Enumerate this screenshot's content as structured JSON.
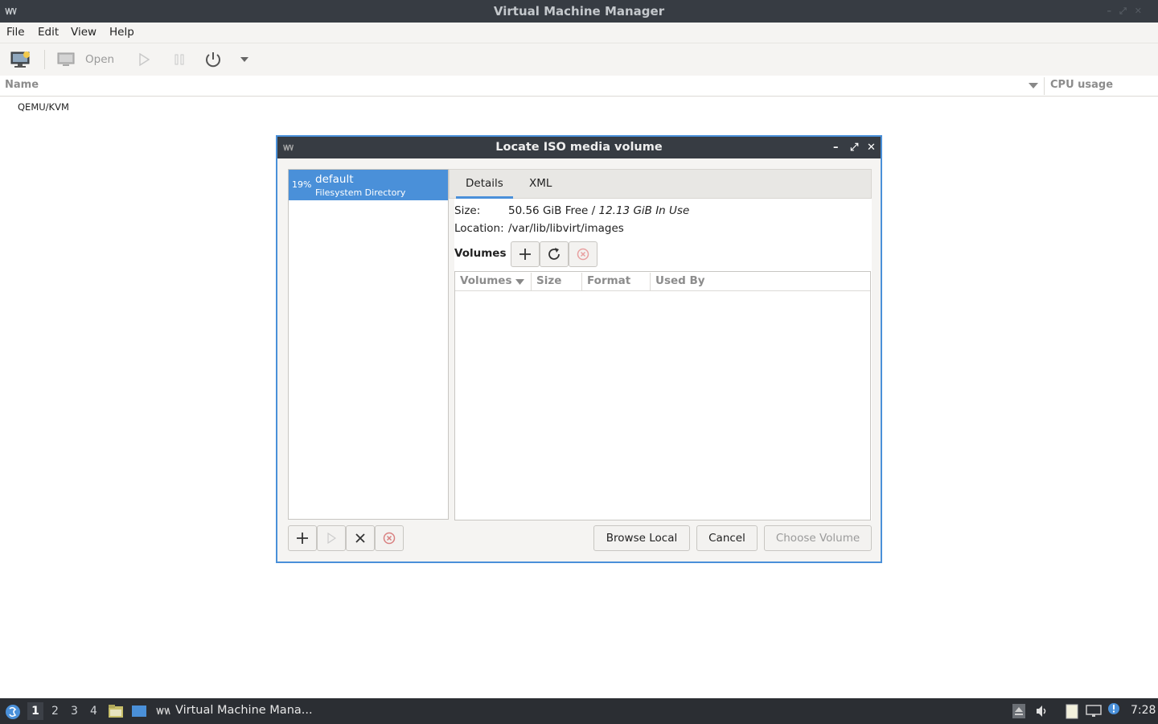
{
  "window": {
    "title": "Virtual Machine Manager"
  },
  "menu": [
    "File",
    "Edit",
    "View",
    "Help"
  ],
  "toolbar": {
    "open_label": "Open"
  },
  "list": {
    "col_name": "Name",
    "col_cpu": "CPU usage",
    "connection": "QEMU/KVM"
  },
  "dialog": {
    "title": "Locate ISO media volume",
    "pool": {
      "percent": "19%",
      "name": "default",
      "type": "Filesystem Directory"
    },
    "tabs": [
      "Details",
      "XML"
    ],
    "size_label": "Size:",
    "size_free": "50.56 GiB Free",
    "size_sep": " / ",
    "size_used": "12.13 GiB In Use",
    "location_label": "Location:",
    "location_value": "/var/lib/libvirt/images",
    "volumes_label": "Volumes",
    "columns": [
      "Volumes",
      "Size",
      "Format",
      "Used By"
    ],
    "buttons": {
      "browse": "Browse Local",
      "cancel": "Cancel",
      "choose": "Choose Volume"
    }
  },
  "taskbar": {
    "workspaces": [
      "1",
      "2",
      "3",
      "4"
    ],
    "task_label": "Virtual Machine Mana...",
    "clock": "7:28"
  },
  "colors": {
    "accent": "#4a90d9",
    "titlebar": "#373c43",
    "taskbar": "#2b2e33"
  }
}
